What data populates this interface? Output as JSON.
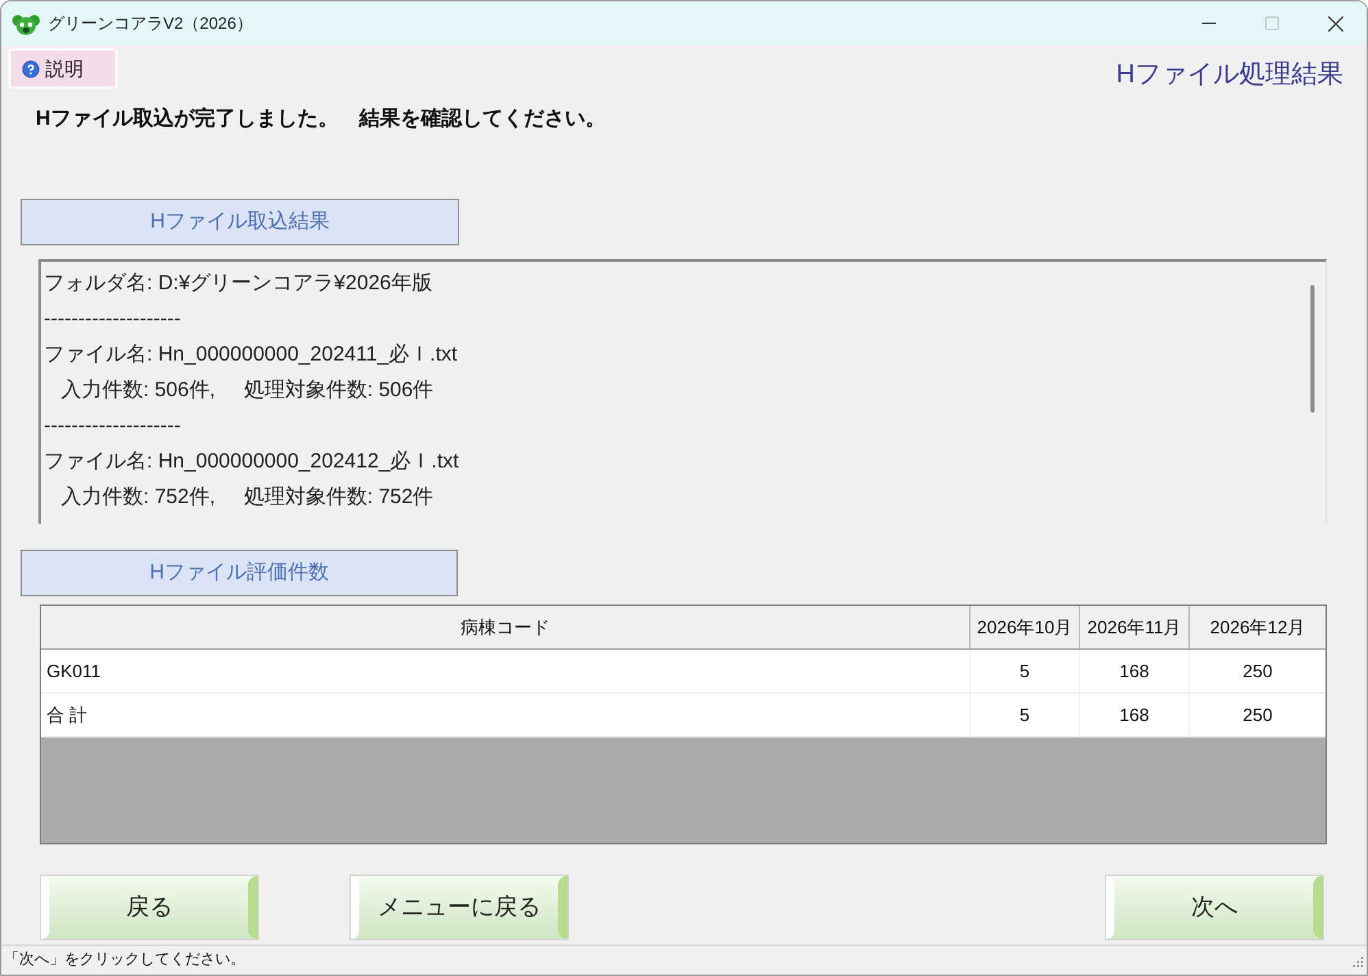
{
  "window": {
    "title": "グリーンコアラV2（2026）",
    "maximize_disabled": true
  },
  "help_button": {
    "label": "説明"
  },
  "page_title": "Hファイル処理結果",
  "message": "Hファイル取込が完了しました。　結果を確認してください。",
  "import_results": {
    "heading": "Hファイル取込結果",
    "lines": [
      "フォルダ名: D:¥グリーンコアラ¥2026年版",
      "--------------------",
      "ファイル名: Hn_000000000_202411_必Ｉ.txt",
      "   入力件数: 506件,     処理対象件数: 506件",
      "--------------------",
      "ファイル名: Hn_000000000_202412_必Ｉ.txt",
      "   入力件数: 752件,     処理対象件数: 752件"
    ]
  },
  "evaluation_counts": {
    "heading": "Hファイル評価件数",
    "columns": [
      "病棟コード",
      "2026年10月",
      "2026年11月",
      "2026年12月"
    ],
    "rows": [
      [
        "GK011",
        "5",
        "168",
        "250"
      ],
      [
        "合 計",
        "5",
        "168",
        "250"
      ]
    ]
  },
  "buttons": [
    {
      "label": "戻る"
    },
    {
      "label": "メニューに戻る"
    },
    {
      "label": "次へ"
    }
  ],
  "status_bar": "「次へ」をクリックしてください。"
}
